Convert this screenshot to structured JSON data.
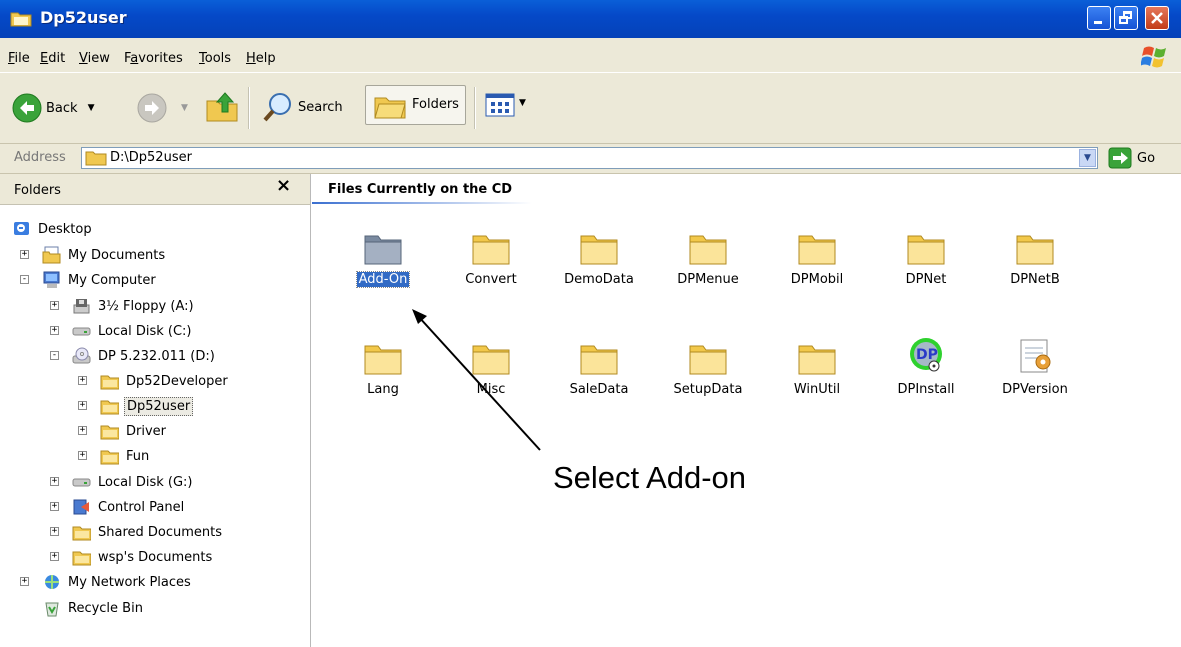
{
  "window": {
    "title": "Dp52user"
  },
  "menu": [
    {
      "label": "File",
      "key": "F",
      "rest": "ile"
    },
    {
      "label": "Edit",
      "key": "E",
      "rest": "dit"
    },
    {
      "label": "View",
      "key": "V",
      "rest": "iew"
    },
    {
      "label": "Favorites",
      "key": "a",
      "pre": "F",
      "rest": "vorites"
    },
    {
      "label": "Tools",
      "key": "T",
      "rest": "ools"
    },
    {
      "label": "Help",
      "key": "H",
      "rest": "elp"
    }
  ],
  "toolbar": {
    "back": "Back",
    "search": "Search",
    "folders": "Folders"
  },
  "address": {
    "label": "Address",
    "value": "D:\\Dp52user",
    "go": "Go"
  },
  "folders_pane": {
    "title": "Folders",
    "close": "×",
    "tree": [
      {
        "label": "Desktop",
        "icon": "desktop-icon"
      },
      {
        "label": "My Documents",
        "icon": "documents-icon"
      },
      {
        "label": "My Computer",
        "icon": "computer-icon"
      },
      {
        "label": "3½ Floppy (A:)",
        "icon": "floppy-icon"
      },
      {
        "label": "Local Disk (C:)",
        "icon": "disk-icon"
      },
      {
        "label": "DP 5.232.011 (D:)",
        "icon": "cd-icon"
      },
      {
        "label": "Dp52Developer",
        "icon": "folder-icon"
      },
      {
        "label": "Dp52user",
        "icon": "folder-icon"
      },
      {
        "label": "Driver",
        "icon": "folder-icon"
      },
      {
        "label": "Fun",
        "icon": "folder-icon"
      },
      {
        "label": "Local Disk (G:)",
        "icon": "disk-icon"
      },
      {
        "label": "Control Panel",
        "icon": "control-panel-icon"
      },
      {
        "label": "Shared Documents",
        "icon": "folder-icon"
      },
      {
        "label": "wsp's Documents",
        "icon": "folder-icon"
      },
      {
        "label": "My Network Places",
        "icon": "network-icon"
      },
      {
        "label": "Recycle Bin",
        "icon": "recycle-bin-icon"
      }
    ]
  },
  "content": {
    "title": "Files Currently on the CD",
    "items": [
      {
        "name": "Add-On",
        "icon": "folder-icon"
      },
      {
        "name": "Convert",
        "icon": "folder-icon"
      },
      {
        "name": "DemoData",
        "icon": "folder-icon"
      },
      {
        "name": "DPMenue",
        "icon": "folder-icon"
      },
      {
        "name": "DPMobil",
        "icon": "folder-icon"
      },
      {
        "name": "DPNet",
        "icon": "folder-icon"
      },
      {
        "name": "DPNetB",
        "icon": "folder-icon"
      },
      {
        "name": "Lang",
        "icon": "folder-icon"
      },
      {
        "name": "Misc",
        "icon": "folder-icon"
      },
      {
        "name": "SaleData",
        "icon": "folder-icon"
      },
      {
        "name": "SetupData",
        "icon": "folder-icon"
      },
      {
        "name": "WinUtil",
        "icon": "folder-icon"
      },
      {
        "name": "DPInstall",
        "icon": "dp-install-icon"
      },
      {
        "name": "DPVersion",
        "icon": "text-file-icon"
      }
    ]
  },
  "annotation": {
    "text": "Select Add-on"
  },
  "colors": {
    "titlebar": "#0549c8",
    "chrome": "#ece9d8",
    "selection": "#316ac5",
    "folder": "#f4d35e"
  }
}
